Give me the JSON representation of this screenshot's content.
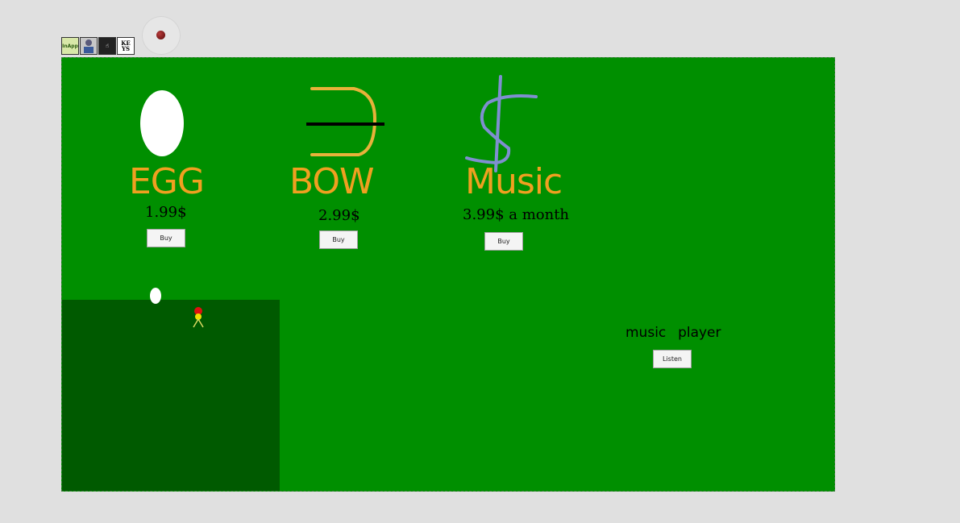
{
  "toolbar": {
    "icons": [
      {
        "name": "inapp-icon",
        "label": "InApp"
      },
      {
        "name": "person-icon",
        "label": ""
      },
      {
        "name": "hand-icon",
        "label": "☝"
      },
      {
        "name": "keys-icon",
        "label": "KE YS"
      }
    ],
    "record_icon": "record-icon"
  },
  "shop": {
    "items": [
      {
        "title": "EGG",
        "price": "1.99$",
        "button": "Buy",
        "icon": "egg-icon"
      },
      {
        "title": "BOW",
        "price": "2.99$",
        "button": "Buy",
        "icon": "bow-icon"
      },
      {
        "title": "Music",
        "price": "3.99$ a month",
        "button": "Buy",
        "icon": "dollar-icon"
      }
    ]
  },
  "music_player": {
    "label": "music  player",
    "button": "Listen"
  },
  "colors": {
    "background": "#e0e0e0",
    "stage": "#008f00",
    "game_area": "#005a00",
    "title_text": "#f0a020",
    "egg": "#ffffff",
    "bow_string": "#000000",
    "dollar": "#7f8fd0"
  }
}
